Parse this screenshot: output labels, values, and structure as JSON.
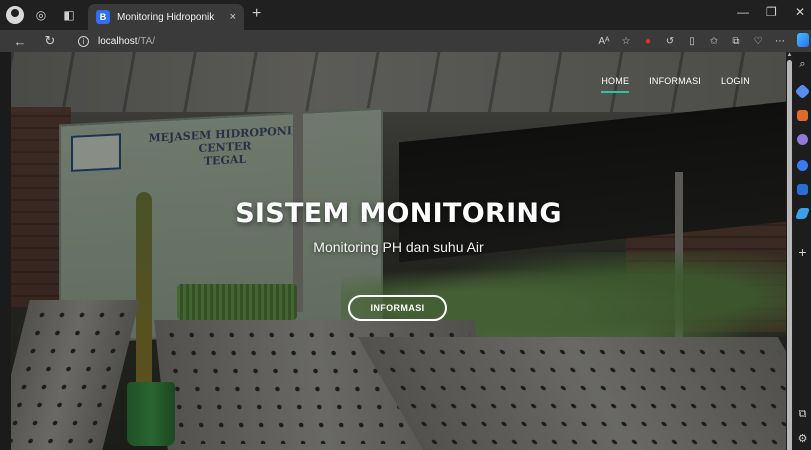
{
  "browser": {
    "tab_title": "Monitoring Hidroponik",
    "tab_favicon_letter": "B",
    "url_host": "localhost",
    "url_path": "/TA/",
    "new_tab_symbol": "+",
    "close_tab_symbol": "×",
    "reader_label": "Aᴬ"
  },
  "site": {
    "nav": [
      "HOME",
      "INFORMASI",
      "LOGIN"
    ],
    "active_nav": "HOME",
    "accent_color": "#2fc3a3"
  },
  "hero": {
    "title": "SISTEM MONITORING",
    "subtitle": "Monitoring PH dan suhu Air",
    "button_label": "INFORMASI"
  },
  "background_banner": {
    "title_line1": "MEJASEM HIDROPONIK CENTER",
    "title_line2": "TEGAL"
  }
}
